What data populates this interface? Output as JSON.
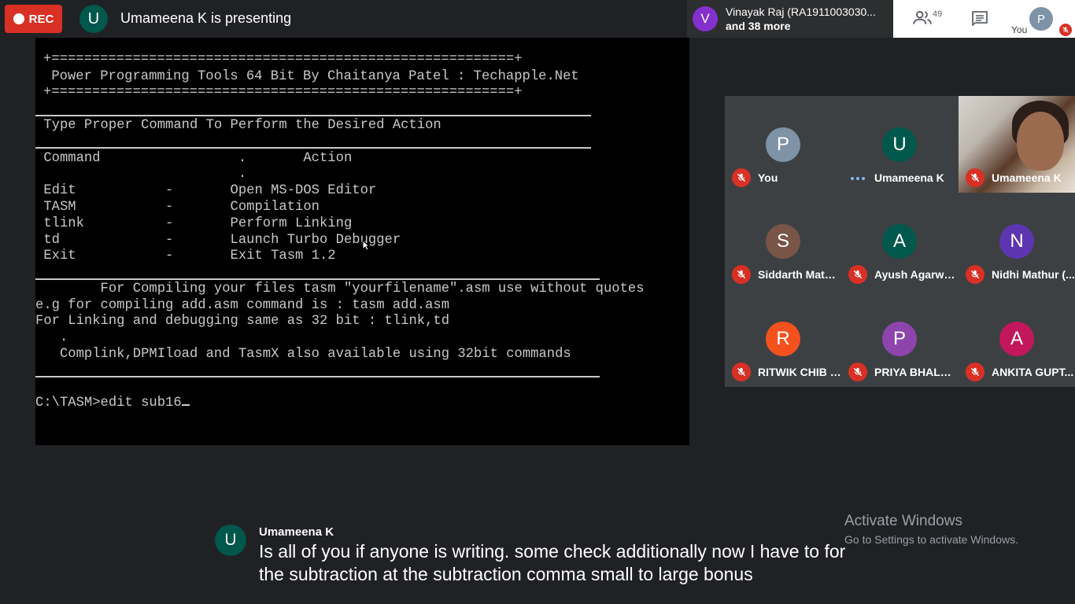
{
  "top_bar": {
    "rec_label": "REC",
    "presenter_initial": "U",
    "presenter_text": "Umameena K is presenting"
  },
  "people_strip": {
    "initial": "V",
    "name": "Vinayak Raj (RA1911003030...",
    "more": "and 38 more"
  },
  "top_right": {
    "participant_count": "49",
    "you_initial": "P",
    "you_label": "You"
  },
  "terminal": {
    "lines": [
      "+=========================================================+",
      " Power Programming Tools 64 Bit By Chaitanya Patel : Techapple.Net",
      "+=========================================================+",
      " Type Proper Command To Perform the Desired Action",
      " Command                 .       Action",
      "                         .",
      " Edit           -       Open MS-DOS Editor",
      " TASM           -       Compilation",
      " tlink          -       Perform Linking",
      " td             -       Launch Turbo Debugger",
      " Exit           -       Exit Tasm 1.2",
      "        For Compiling your files tasm \"yourfilename\".asm use without quotes",
      "e.g for compiling add.asm command is : tasm add.asm",
      "For Linking and debugging same as 32 bit : tlink,td",
      "   .",
      "   Complink,DPMIload and TasmX also available using 32bit commands",
      "C:\\TASM>edit sub16"
    ]
  },
  "participants": [
    {
      "initial": "P",
      "name": "You",
      "color": "#7e93a5"
    },
    {
      "initial": "U",
      "name": "Umameena K",
      "color": "#00574b"
    },
    {
      "initial": "",
      "name": "Umameena K",
      "color": ""
    },
    {
      "initial": "S",
      "name": "Siddarth Mathu...",
      "color": "#795548"
    },
    {
      "initial": "A",
      "name": "Ayush Agarwal...",
      "color": "#00574b"
    },
    {
      "initial": "N",
      "name": "Nidhi Mathur (...",
      "color": "#5e35b1"
    },
    {
      "initial": "R",
      "name": "RITWIK CHIB (...",
      "color": "#f4511e"
    },
    {
      "initial": "P",
      "name": "PRIYA BHALOT...",
      "color": "#8e44ad"
    },
    {
      "initial": "A",
      "name": "ANKITA GUPT...",
      "color": "#c2185b"
    }
  ],
  "caption": {
    "initial": "U",
    "speaker": "Umameena K",
    "text": "Is all of you if anyone is writing. some check additionally now I have to for the subtraction at the subtraction comma small to large bonus"
  },
  "watermark": {
    "title": "Activate Windows",
    "subtitle": "Go to Settings to activate Windows."
  },
  "colors": {
    "rec": "#d93025",
    "background": "#202124",
    "grid_background": "#3c4043",
    "speaking_dots": "#8ab4f8"
  }
}
